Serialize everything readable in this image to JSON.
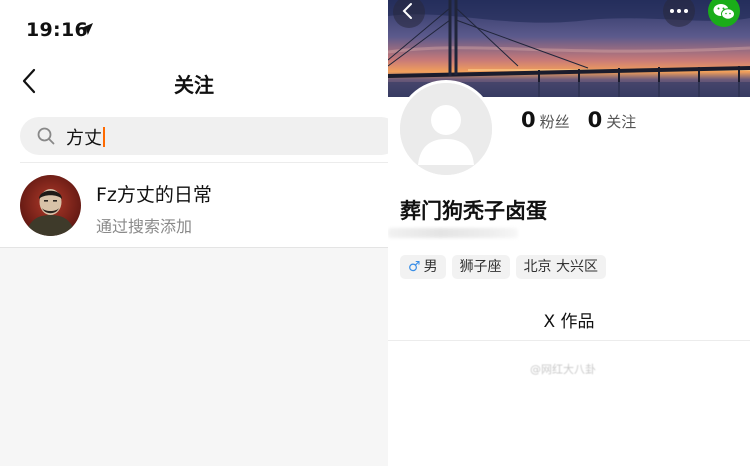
{
  "status_bar": {
    "time": "19:16",
    "location_icon": "location-arrow-icon"
  },
  "left_nav": {
    "title": "关注",
    "back_icon": "chevron-left-icon"
  },
  "search": {
    "value": "方丈",
    "icon": "search-icon",
    "caret_color": "#ff6a00"
  },
  "result": {
    "name": "Fz方丈的日常",
    "subtitle": "通过搜索添加",
    "avatar_icon": "user-avatar"
  },
  "profile": {
    "back_icon": "chevron-left-icon",
    "more_icon": "more-dots-icon",
    "wechat_icon": "wechat-icon",
    "fans_count": "0",
    "fans_label": "粉丝",
    "following_count": "0",
    "following_label": "关注",
    "nickname": "葬门狗秃子卤蛋",
    "tags": {
      "gender_symbol": "♂",
      "gender": "男",
      "zodiac": "狮子座",
      "location": "北京 大兴区"
    },
    "works_label": "X 作品",
    "watermark": "@网红大八卦"
  },
  "colors": {
    "wechat_green": "#1aad19",
    "gender_blue": "#3a8ee6",
    "page_bg": "#f6f6f6"
  }
}
